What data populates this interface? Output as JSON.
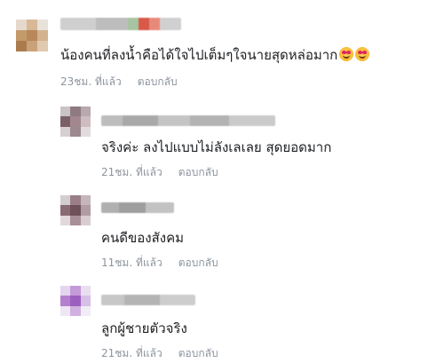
{
  "comments": [
    {
      "text": "น้องคนที่ลงน้ำคือได้ใจไปเต็มๆใจนายสุดหล่อมาก",
      "emojis": [
        "smiling-face-with-heart-eyes-emoji",
        "smiling-face-with-heart-eyes-emoji"
      ],
      "time": "23ชม. ที่แล้ว",
      "reply_label": "ตอบกลับ"
    },
    {
      "text": "จริงค่ะ ลงไปแบบไม่ลังเลเลย สุดยอดมาก",
      "time": "21ชม. ที่แล้ว",
      "reply_label": "ตอบกลับ"
    },
    {
      "text": "คนดีของสังคม",
      "time": "11ชม. ที่แล้ว",
      "reply_label": "ตอบกลับ"
    },
    {
      "text": "ลูกผู้ชายตัวจริง",
      "time": "21ชม. ที่แล้ว",
      "reply_label": "ตอบกลับ"
    }
  ],
  "colors": {
    "text": "#1c1e21",
    "meta": "#8d949e",
    "background": "#ffffff"
  }
}
